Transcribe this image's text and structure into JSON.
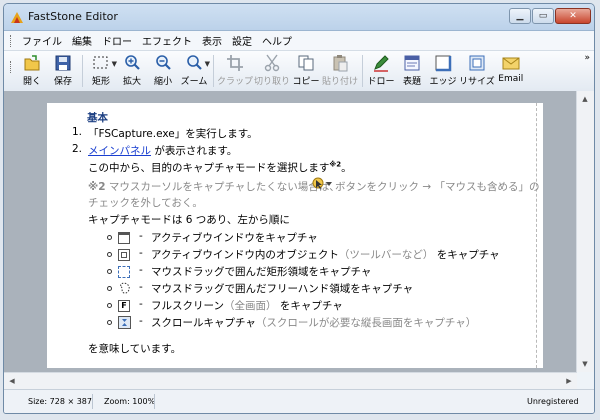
{
  "window": {
    "title": "FastStone Editor"
  },
  "menu": [
    "ファイル",
    "編集",
    "ドロー",
    "エフェクト",
    "表示",
    "設定",
    "ヘルプ"
  ],
  "toolbar": {
    "items": [
      {
        "label": "開く",
        "icon": "open-folder-icon"
      },
      {
        "label": "保存",
        "icon": "save-disk-icon"
      },
      {
        "label": "矩形",
        "icon": "rectangle-select-icon"
      },
      {
        "label": "拡大",
        "icon": "zoom-in-icon"
      },
      {
        "label": "縮小",
        "icon": "zoom-out-icon"
      },
      {
        "label": "ズーム",
        "icon": "zoom-icon"
      },
      {
        "label": "クラップ",
        "icon": "crop-icon"
      },
      {
        "label": "切り取り",
        "icon": "scissors-icon"
      },
      {
        "label": "コピー",
        "icon": "copy-icon"
      },
      {
        "label": "貼り付け",
        "icon": "paste-icon"
      },
      {
        "label": "ドロー",
        "icon": "draw-pen-icon"
      },
      {
        "label": "表題",
        "icon": "caption-icon"
      },
      {
        "label": "エッジ",
        "icon": "edge-icon"
      },
      {
        "label": "リサイズ",
        "icon": "resize-icon"
      },
      {
        "label": "Email",
        "icon": "email-icon"
      }
    ],
    "more": "»"
  },
  "document": {
    "heading": "基本",
    "step1_num": "1.",
    "step1_text": "「FSCapture.exe」を実行します。",
    "step2_num": "2.",
    "step2_link": "メインパネル",
    "step2_text": " が表示されます。",
    "line3": "この中から、目的のキャプチャモードを選択します",
    "line3_sup": "※2",
    "line3_end": "。",
    "note_mark": "※2",
    "note_text1": " マウスカーソルをキャプチャしたくない場合は、",
    "note_text2": " ボタンをクリック → 「マウスも含める」の",
    "note_text3": "チェックを外しておく。",
    "modes_intro": "キャプチャモードは 6 つあり、左から順に",
    "modes": [
      {
        "text": "アクティブウインドウをキャプチャ",
        "extra": "",
        "tail": ""
      },
      {
        "text": "アクティブウインドウ内のオブジェクト",
        "extra": "（ツールバーなど）",
        "tail": " をキャプチャ"
      },
      {
        "text": "マウスドラッグで囲んだ矩形領域をキャプチャ",
        "extra": "",
        "tail": ""
      },
      {
        "text": "マウスドラッグで囲んだフリーハンド領域をキャプチャ",
        "extra": "",
        "tail": ""
      },
      {
        "text": "フルスクリーン",
        "extra": "（全画面）",
        "tail": " をキャプチャ"
      },
      {
        "text": "スクロールキャプチャ",
        "extra": "（スクロールが必要な縦長画面をキャプチャ）",
        "tail": ""
      }
    ],
    "dash": "-",
    "closing": "を意味しています。"
  },
  "status": {
    "size": "Size: 728 × 387",
    "zoom": "Zoom: 100%",
    "registration": "Unregistered"
  }
}
